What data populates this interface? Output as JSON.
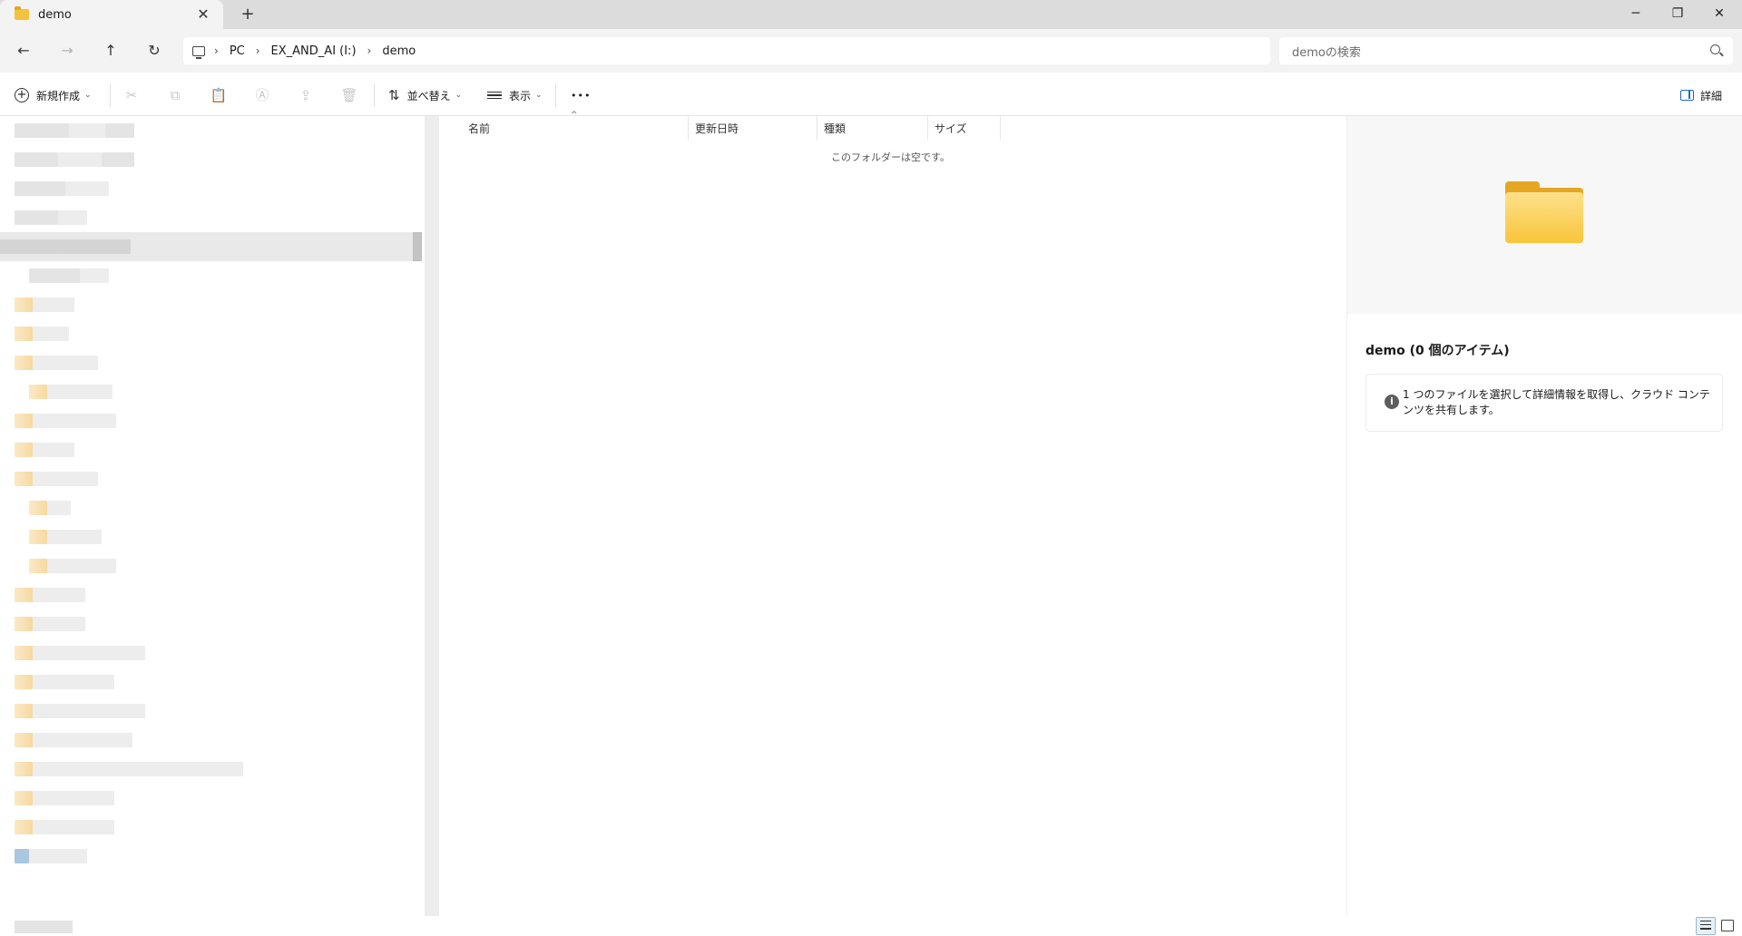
{
  "window": {
    "tab_title": "demo",
    "tab_close": "✕",
    "new_tab": "+",
    "minimize": "─",
    "restore": "❐",
    "close": "✕"
  },
  "nav_buttons": {
    "back": "←",
    "forward": "→",
    "up": "↑",
    "refresh": "↻"
  },
  "breadcrumb": [
    "PC",
    "EX_AND_AI (I:)",
    "demo"
  ],
  "breadcrumb_separator": "›",
  "search": {
    "placeholder": "demoの検索"
  },
  "commands": {
    "new": "新規作成",
    "sort": "並べ替え",
    "view": "表示",
    "more": "•••",
    "details": "詳細",
    "cut_icon": "✂",
    "copy_icon": "⧉",
    "paste_icon": "📋",
    "rename_icon": "Ⓐ",
    "share_icon": "⇪",
    "delete_icon": "🗑"
  },
  "columns": {
    "name": "名前",
    "modified": "更新日時",
    "type": "種類",
    "size": "サイズ"
  },
  "empty_message": "このフォルダーは空です。",
  "details_pane": {
    "title": "demo (0 個のアイテム)",
    "info": "1 つのファイルを選択して詳細情報を取得し、クラウド コンテンツを共有します。",
    "info_icon": "i"
  },
  "colors": {
    "accent": "#1a6fc0",
    "folder": "#f8c53b",
    "selection": "#e9e9e9"
  }
}
